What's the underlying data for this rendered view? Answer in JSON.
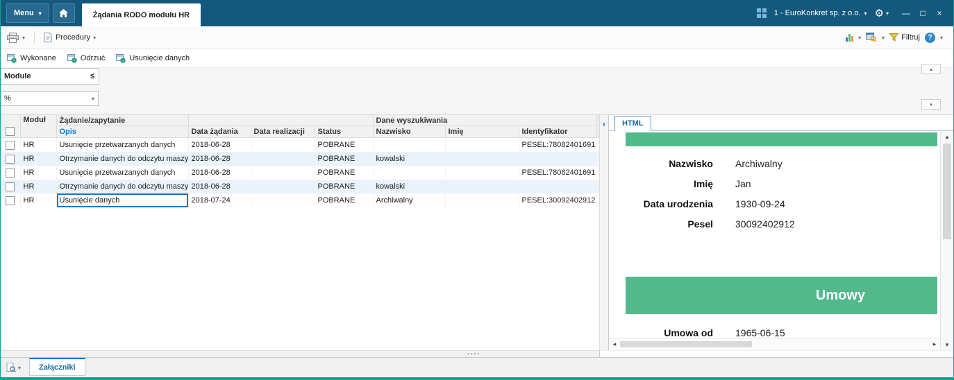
{
  "titlebar": {
    "menu_label": "Menu",
    "tab_title": "Żądania RODO modułu HR",
    "company_selector": "1 - EuroKonkret sp. z o.o."
  },
  "toolbar": {
    "procedury_label": "Procedury",
    "filtruj_label": "Filtruj",
    "help_glyph": "?"
  },
  "actions": {
    "wykonane": "Wykonane",
    "odrzuc": "Odrzuć",
    "usuniecie": "Usunięcie danych"
  },
  "filter": {
    "label": "Module",
    "operator": "≤",
    "value": "%"
  },
  "table": {
    "headers": {
      "modul": "Moduł",
      "zadanie": "Żądanie/zapytanie",
      "dane_wyszukiwania": "Dane wyszukiwania",
      "opis": "Opis",
      "data_zadania": "Data żądania",
      "data_realizacji": "Data realizacji",
      "status": "Status",
      "nazwisko": "Nazwisko",
      "imie": "Imię",
      "identyfikator": "Identyfikator"
    },
    "rows": [
      {
        "modul": "HR",
        "opis": "Usunięcie przetwarzanych danych",
        "data_zadania": "2018-06-28",
        "data_realizacji": "",
        "status": "POBRANE",
        "nazwisko": "",
        "imie": "",
        "identyfikator": "PESEL:78082401691"
      },
      {
        "modul": "HR",
        "opis": "Otrzymanie danych do odczytu maszyn",
        "data_zadania": "2018-06-28",
        "data_realizacji": "",
        "status": "POBRANE",
        "nazwisko": "kowalski",
        "imie": "",
        "identyfikator": ""
      },
      {
        "modul": "HR",
        "opis": "Usunięcie przetwarzanych danych",
        "data_zadania": "2018-06-28",
        "data_realizacji": "",
        "status": "POBRANE",
        "nazwisko": "",
        "imie": "",
        "identyfikator": "PESEL:78082401691"
      },
      {
        "modul": "HR",
        "opis": "Otrzymanie danych do odczytu maszyn",
        "data_zadania": "2018-06-28",
        "data_realizacji": "",
        "status": "POBRANE",
        "nazwisko": "kowalski",
        "imie": "",
        "identyfikator": ""
      },
      {
        "modul": "HR",
        "opis": "Usunięcie danych",
        "data_zadania": "2018-07-24",
        "data_realizacji": "",
        "status": "POBRANE",
        "nazwisko": "Archiwalny",
        "imie": "",
        "identyfikator": "PESEL:30092402912"
      }
    ]
  },
  "detail": {
    "tab_label": "HTML",
    "fields": [
      {
        "label": "Nazwisko",
        "value": "Archiwalny"
      },
      {
        "label": "Imię",
        "value": "Jan"
      },
      {
        "label": "Data urodzenia",
        "value": "1930-09-24"
      },
      {
        "label": "Pesel",
        "value": "30092402912"
      }
    ],
    "section": {
      "title": "Umowy",
      "fields": [
        {
          "label": "Umowa od",
          "value": "1965-06-15"
        }
      ]
    }
  },
  "bottom": {
    "attachments_tab": "Załączniki"
  },
  "colors": {
    "titlebar_blue": "#15587e",
    "accent_green": "#53b98c",
    "link_blue": "#1376c9",
    "status_teal": "#12a192"
  }
}
